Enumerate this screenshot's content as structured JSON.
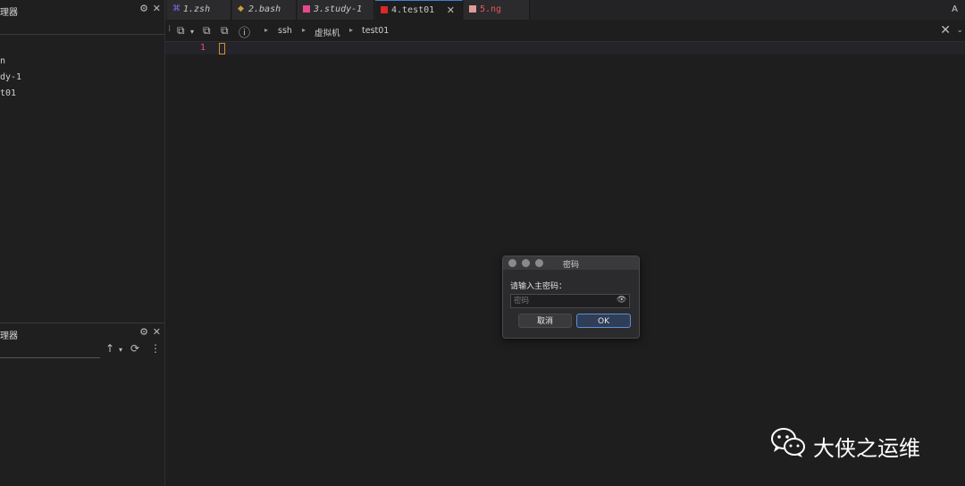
{
  "session_manager": {
    "title": "理器",
    "sessions": [
      "n",
      "dy-1",
      "t01"
    ]
  },
  "file_manager": {
    "title": "理器"
  },
  "tabs": [
    {
      "label": "1.zsh",
      "icon": "zsh-icon",
      "color": "#7b6ee8",
      "italic": true
    },
    {
      "label": "2.bash",
      "icon": "bash-icon",
      "color": "#c6a03a",
      "italic": true
    },
    {
      "label": "3.study-1",
      "icon": "square-icon",
      "color": "#e8488b",
      "italic": true
    },
    {
      "label": "4.test01",
      "icon": "square-icon",
      "color": "#d82a2a",
      "italic": false,
      "active": true
    },
    {
      "label": "5.ng",
      "icon": "square-icon",
      "color": "#e05858",
      "italic": false
    }
  ],
  "font_toggle": "A",
  "breadcrumb": [
    "ssh",
    "虚拟机",
    "test01"
  ],
  "editor": {
    "line_number": "1"
  },
  "dialog": {
    "title": "密码",
    "prompt": "请输入主密码：",
    "placeholder": "密码",
    "cancel_label": "取消",
    "ok_label": "OK"
  },
  "watermark": {
    "text": "大侠之运维"
  },
  "colors": {
    "accent": "#3b7fd4",
    "line_number": "#e8488b",
    "cursor": "#d98b2e"
  }
}
